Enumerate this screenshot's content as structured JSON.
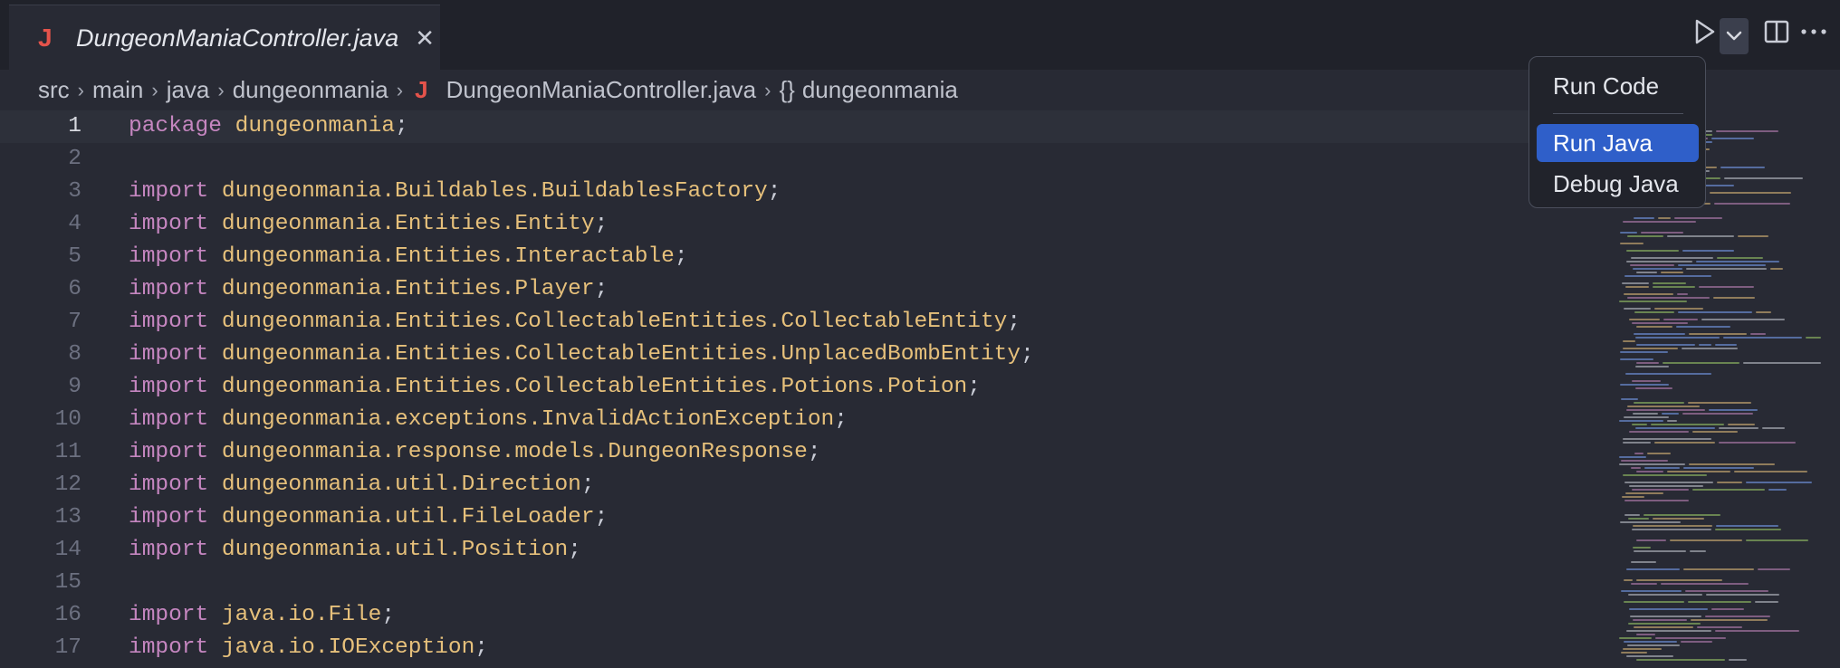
{
  "tab": {
    "icon": "J",
    "title": "DungeonManiaController.java",
    "close": "✕"
  },
  "breadcrumb": {
    "items": [
      "src",
      "main",
      "java",
      "dungeonmania"
    ],
    "file_icon": "J",
    "file": "DungeonManiaController.java",
    "symbol_icon": "{}",
    "symbol": "dungeonmania"
  },
  "menu": {
    "run_code": "Run Code",
    "run_java": "Run Java",
    "debug_java": "Debug Java"
  },
  "code": [
    {
      "n": "1",
      "kw": "package",
      "rest": "dungeonmania",
      "semi": ";"
    },
    {
      "n": "2",
      "kw": "",
      "rest": "",
      "semi": ""
    },
    {
      "n": "3",
      "kw": "import",
      "rest": "dungeonmania.Buildables.BuildablesFactory",
      "semi": ";"
    },
    {
      "n": "4",
      "kw": "import",
      "rest": "dungeonmania.Entities.Entity",
      "semi": ";"
    },
    {
      "n": "5",
      "kw": "import",
      "rest": "dungeonmania.Entities.Interactable",
      "semi": ";"
    },
    {
      "n": "6",
      "kw": "import",
      "rest": "dungeonmania.Entities.Player",
      "semi": ";"
    },
    {
      "n": "7",
      "kw": "import",
      "rest": "dungeonmania.Entities.CollectableEntities.CollectableEntity",
      "semi": ";"
    },
    {
      "n": "8",
      "kw": "import",
      "rest": "dungeonmania.Entities.CollectableEntities.UnplacedBombEntity",
      "semi": ";"
    },
    {
      "n": "9",
      "kw": "import",
      "rest": "dungeonmania.Entities.CollectableEntities.Potions.Potion",
      "semi": ";"
    },
    {
      "n": "10",
      "kw": "import",
      "rest": "dungeonmania.exceptions.InvalidActionException",
      "semi": ";"
    },
    {
      "n": "11",
      "kw": "import",
      "rest": "dungeonmania.response.models.DungeonResponse",
      "semi": ";"
    },
    {
      "n": "12",
      "kw": "import",
      "rest": "dungeonmania.util.Direction",
      "semi": ";"
    },
    {
      "n": "13",
      "kw": "import",
      "rest": "dungeonmania.util.FileLoader",
      "semi": ";"
    },
    {
      "n": "14",
      "kw": "import",
      "rest": "dungeonmania.util.Position",
      "semi": ";"
    },
    {
      "n": "15",
      "kw": "",
      "rest": "",
      "semi": ""
    },
    {
      "n": "16",
      "kw": "import",
      "rest": "java.io.File",
      "semi": ";"
    },
    {
      "n": "17",
      "kw": "import",
      "rest": "java.io.IOException",
      "semi": ";"
    }
  ],
  "colors": {
    "keyword": "#c586c0",
    "identifier": "#e6c07b",
    "accent": "#2f5fc9",
    "java_icon": "#e5534b"
  }
}
